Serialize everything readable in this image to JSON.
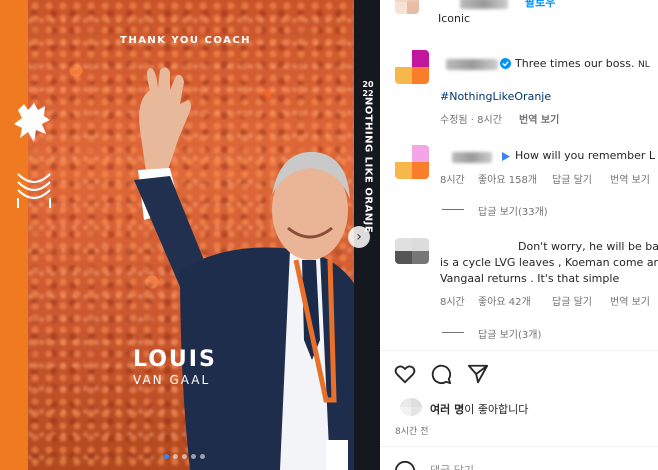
{
  "media": {
    "thank_you": "THANK YOU COACH",
    "side_year_line1": "20",
    "side_year_line2": "22",
    "side_text": "NOTHING LIKE ORANJE",
    "name_first": "LOUIS",
    "name_last": "VAN GAAL",
    "carousel_dots": 5,
    "active_dot": 0
  },
  "top_partial": {
    "label": "Iconic",
    "follow": "팔로우"
  },
  "comments": [
    {
      "text": "Three times our boss.",
      "country": "NL",
      "hashtag": "#NothingLikeOranje",
      "time": "수정됨 · 8시간",
      "translate": "번역 보기",
      "avatar_colors": [
        "#ffffff",
        "#c2169c",
        "#f7b84b",
        "#f97d2a"
      ]
    },
    {
      "text": "How will you remember L",
      "time": "8시간",
      "likes": "좋아요 158개",
      "reply": "답글 달기",
      "translate": "번역 보기",
      "view_replies": "답글 보기(33개)",
      "avatar_colors": [
        "#ffffff",
        "#f3a5e6",
        "#f7b84b",
        "#f97d2a"
      ]
    },
    {
      "line1": "Don't worry, he will be ba",
      "line2": "is a cycle LVG leaves , Koeman come an",
      "line3": "Vangaal returns . It's that simple",
      "time": "8시간",
      "likes": "좋아요 42개",
      "reply": "답글 달기",
      "translate": "번역 보기",
      "view_replies": "답글 보기(3개)",
      "avatar_colors": [
        "#e0e0e0",
        "#dcdcdc",
        "#555555",
        "#777777"
      ]
    }
  ],
  "actions": {
    "likes_text_bold": "여러 명",
    "likes_text_rest": "이 좋아합니다",
    "post_time": "8시간 전",
    "comment_placeholder": "댓글 달기..."
  },
  "colors": {
    "orange": "#f07a1f",
    "dark": "#16181f",
    "verified": "#0095f6",
    "hashtag": "#00376b"
  }
}
